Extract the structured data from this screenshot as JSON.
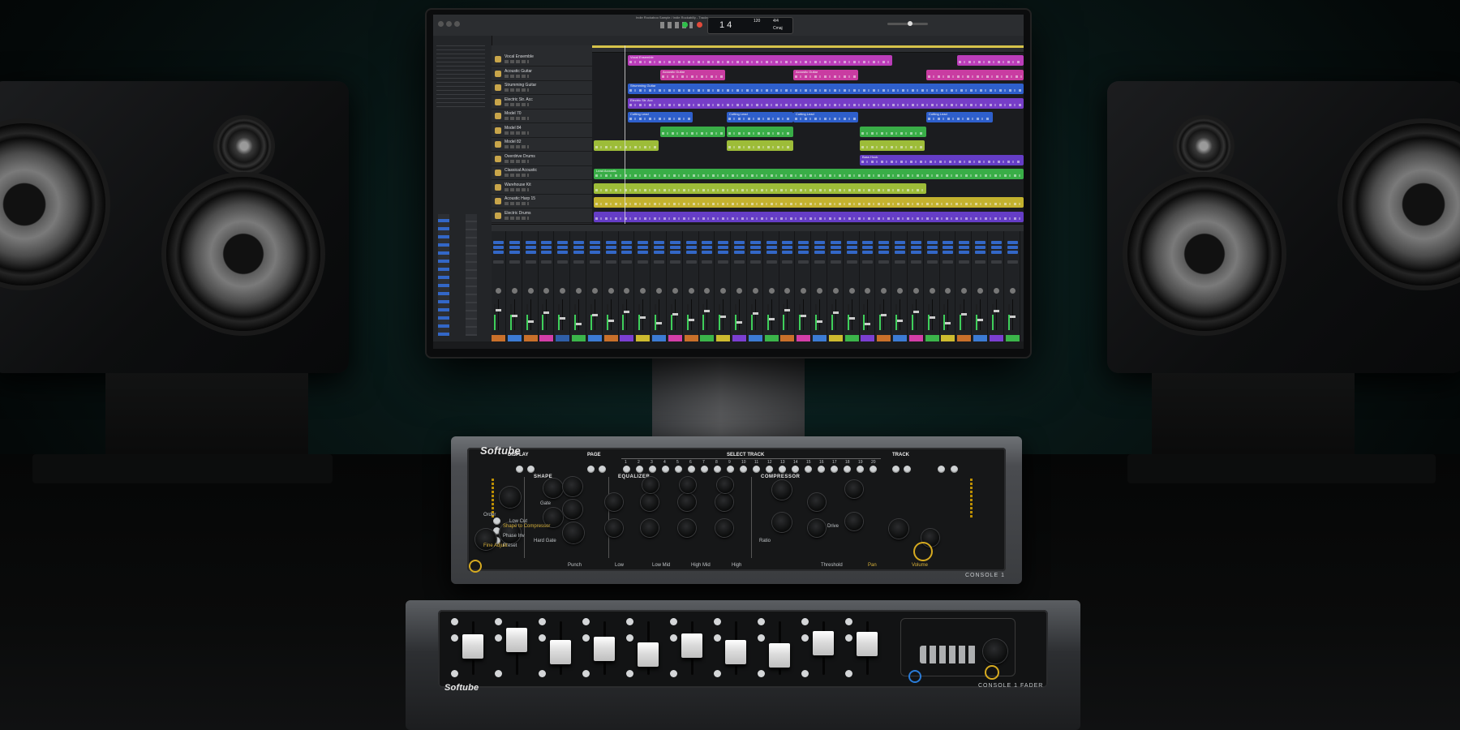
{
  "monitor": {
    "window_title": "Indie Rockaboo Sample / Indie Rockabilly - Tracks",
    "lcd": {
      "position": "1 4",
      "tempo": "120",
      "key": "Cmaj",
      "time_sig": "4/4"
    },
    "track_names": [
      "Vocal Ensemble",
      "Acoustic Guitar",
      "Strumming Guitar",
      "Electric Str. Acc",
      "Model 70",
      "Model 84",
      "Model 82",
      "Overdrive Drums",
      "Classical Acoustic",
      "Warehouse Kit",
      "Acoustic Harp 15",
      "Electric Drums"
    ],
    "region_labels": [
      "Vocal Ensemble",
      "Acoustic Guitar",
      "Strumming Guitar",
      "Electric Str. Acc",
      "Cutting Lead",
      "Lead Acoustic",
      "Bass Hook"
    ],
    "mixer_channel_count": 33,
    "colors": {
      "magenta": "#c43fc2",
      "pink": "#d33ea8",
      "blue": "#3063d6",
      "purple": "#7b3fd1",
      "green": "#3bb54a",
      "lime": "#a5c53a",
      "yellow": "#cdbb2f",
      "violet": "#6a3fcf"
    }
  },
  "console1": {
    "brand": "Softube",
    "model": "CONSOLE 1",
    "labels": {
      "display": "DISPLAY",
      "page": "PAGE",
      "select_track": "SELECT TRACK",
      "track": "TRACK",
      "shape": "SHAPE",
      "equalizer": "EQUALIZER",
      "compressor": "COMPRESSOR",
      "low_cut": "Low Cut",
      "gate": "Gate",
      "hard_gate": "Hard Gate",
      "punch": "Punch",
      "low": "Low",
      "low_mid": "Low Mid",
      "high_mid": "High Mid",
      "high": "High",
      "threshold": "Threshold",
      "pan": "Pan",
      "volume": "Volume",
      "drive": "Drive",
      "order": "Order",
      "fine_adjust": "Fine Adjust",
      "shape_to_compressor": "Shape to Compressor",
      "phase_inv": "Phase Inv",
      "preset": "Preset",
      "ratio": "Ratio"
    },
    "track_numbers": [
      "1",
      "2",
      "3",
      "4",
      "5",
      "6",
      "7",
      "8",
      "9",
      "10",
      "11",
      "12",
      "13",
      "14",
      "15",
      "16",
      "17",
      "18",
      "19",
      "20"
    ]
  },
  "fader": {
    "brand": "Softube",
    "model": "CONSOLE 1 FADER",
    "fader_levels": [
      0.68,
      0.84,
      0.55,
      0.62,
      0.48,
      0.7,
      0.55,
      0.46,
      0.76,
      0.74
    ]
  }
}
